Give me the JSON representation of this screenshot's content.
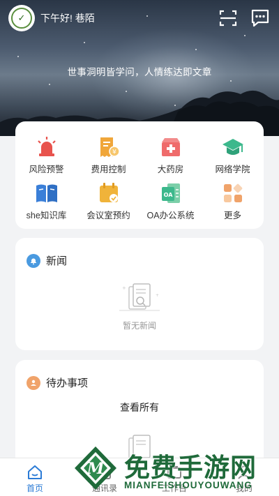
{
  "header": {
    "greeting": "下午好! 巷陌",
    "motto": "世事洞明皆学问，人情练达即文章"
  },
  "menu": [
    {
      "label": "风险预警",
      "icon": "alarm-icon",
      "color": "#e8534d"
    },
    {
      "label": "费用控制",
      "icon": "receipt-icon",
      "color": "#f0a63a"
    },
    {
      "label": "大药房",
      "icon": "pharmacy-icon",
      "color": "#ef6b6b"
    },
    {
      "label": "网络学院",
      "icon": "graduation-cap-icon",
      "color": "#3cb88c"
    },
    {
      "label": "she知识库",
      "icon": "book-icon",
      "color": "#3a7fd8"
    },
    {
      "label": "会议室预约",
      "icon": "calendar-icon",
      "color": "#f0b33a"
    },
    {
      "label": "OA办公系统",
      "icon": "oa-doc-icon",
      "color": "#3cb88c"
    },
    {
      "label": "更多",
      "icon": "grid-more-icon",
      "color": "#f0a36a"
    }
  ],
  "news": {
    "title": "新闻",
    "empty_text": "暂无新闻",
    "accent": "#4a9ae0"
  },
  "todo": {
    "title": "待办事项",
    "view_all": "查看所有",
    "accent": "#f0a36a"
  },
  "tabs": [
    {
      "label": "首页",
      "icon": "home-icon",
      "active": true
    },
    {
      "label": "通讯录",
      "icon": "contacts-icon",
      "active": false
    },
    {
      "label": "工作台",
      "icon": "workbench-icon",
      "active": false
    },
    {
      "label": "我的",
      "icon": "user-icon",
      "active": false
    }
  ],
  "watermark": {
    "title": "免费手游网",
    "subtitle": "MIANFEISHOUYOUWANG",
    "logo_letter": "M"
  },
  "colors": {
    "active_tab": "#2b7bd6",
    "watermark": "#1f6a3a"
  }
}
